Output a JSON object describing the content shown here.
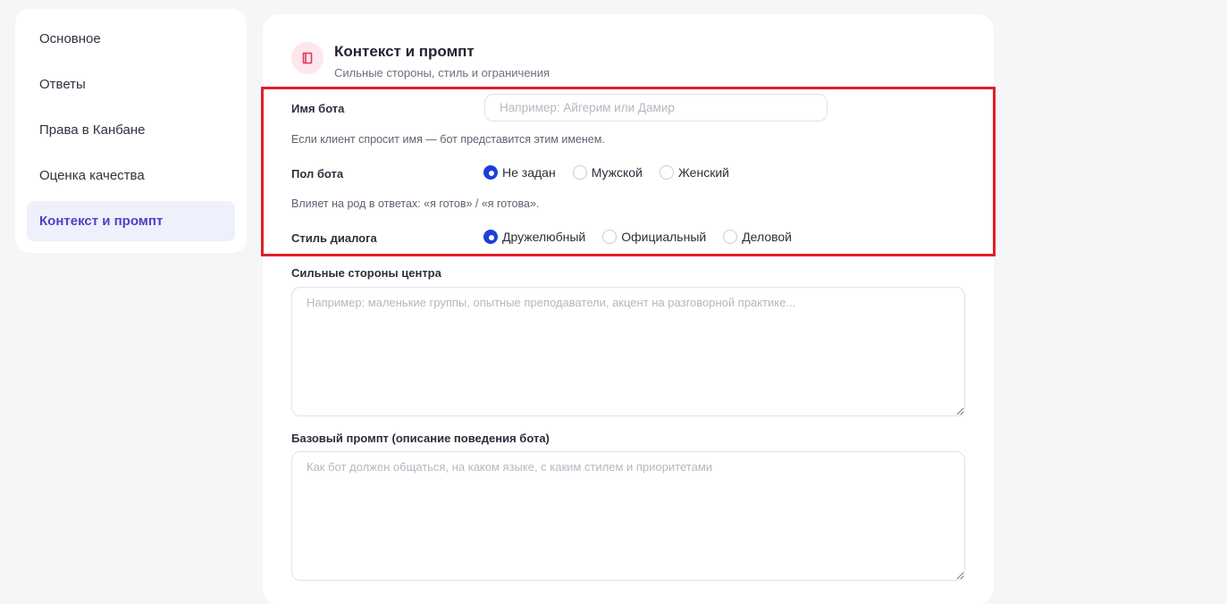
{
  "sidebar": {
    "items": [
      {
        "label": "Основное",
        "active": false
      },
      {
        "label": "Ответы",
        "active": false
      },
      {
        "label": "Права в Канбане",
        "active": false
      },
      {
        "label": "Оценка качества",
        "active": false
      },
      {
        "label": "Контекст и промпт",
        "active": true
      }
    ]
  },
  "section": {
    "icon": "book-icon",
    "accent_color": "#e0365f",
    "title": "Контекст и промпт",
    "subtitle": "Сильные стороны, стиль и ограничения"
  },
  "bot_name": {
    "label": "Имя бота",
    "value": "",
    "placeholder": "Например: Айгерим или Дамир",
    "hint": "Если клиент спросит имя — бот представится этим именем."
  },
  "bot_gender": {
    "label": "Пол бота",
    "options": [
      "Не задан",
      "Мужской",
      "Женский"
    ],
    "selected": "Не задан",
    "hint": "Влияет на род в ответах: «я готов» / «я готова»."
  },
  "dialog_style": {
    "label": "Стиль диалога",
    "options": [
      "Дружелюбный",
      "Официальный",
      "Деловой"
    ],
    "selected": "Дружелюбный"
  },
  "strengths": {
    "label": "Сильные стороны центра",
    "value": "",
    "placeholder": "Например: маленькие группы, опытные преподаватели, акцент на разговорной практике..."
  },
  "base_prompt": {
    "label": "Базовый промпт (описание поведения бота)",
    "value": "",
    "placeholder": "Как бот должен общаться, на каком языке, с каким стилем и приоритетами"
  },
  "colors": {
    "primary": "#1e3fd8",
    "active_nav_text": "#4b43c7",
    "active_nav_bg": "#eef0fb",
    "highlight_border": "#e01f26"
  }
}
